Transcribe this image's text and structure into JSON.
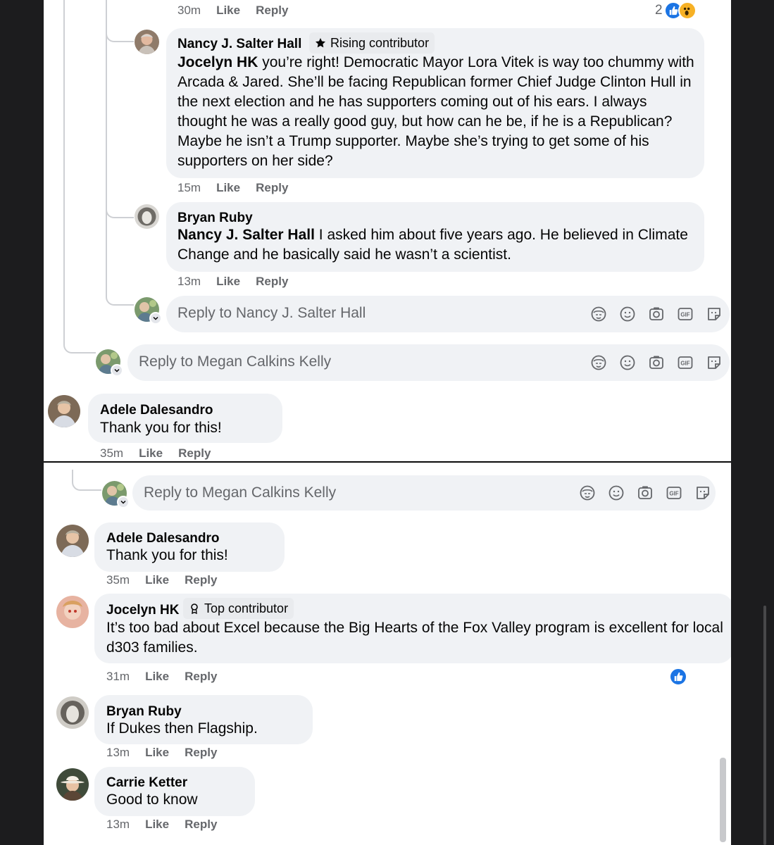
{
  "top": {
    "header_meta": {
      "time": "30m",
      "like": "Like",
      "reply": "Reply"
    },
    "header_reactions": {
      "count": "2",
      "icons": [
        "like-icon",
        "wow-icon"
      ]
    },
    "comments": [
      {
        "author": "Nancy J. Salter Hall",
        "badge": "Rising contributor",
        "badge_icon": "star-icon",
        "mention": "Jocelyn HK",
        "text": "you’re right! Democratic Mayor Lora Vitek is way too chummy with Arcada & Jared. She’ll be facing Republican former Chief Judge Clinton Hull in the next election and he has supporters coming out of his ears. I always thought he was a really good guy, but how can he be, if he is a Republican? Maybe he isn’t a Trump supporter. Maybe she’s trying to get some of his supporters on her side?",
        "time": "15m",
        "like": "Like",
        "reply": "Reply"
      },
      {
        "author": "Bryan Ruby",
        "mention": "Nancy J. Salter Hall",
        "text": "I asked him about five years ago. He believed in Climate Change and he basically said he wasn’t a scientist.",
        "time": "13m",
        "like": "Like",
        "reply": "Reply"
      }
    ],
    "reply_input_nested": {
      "placeholder": "Reply to Nancy J. Salter Hall"
    },
    "reply_input_outer": {
      "placeholder": "Reply to Megan Calkins Kelly"
    },
    "adele": {
      "author": "Adele Dalesandro",
      "text": "Thank you for this!",
      "time": "35m",
      "like": "Like",
      "reply": "Reply"
    }
  },
  "bottom": {
    "reply_input": {
      "placeholder": "Reply to Megan Calkins Kelly"
    },
    "comments": [
      {
        "author": "Adele Dalesandro",
        "text": "Thank you for this!",
        "time": "35m",
        "like": "Like",
        "reply": "Reply"
      },
      {
        "author": "Jocelyn HK",
        "badge": "Top contributor",
        "badge_icon": "award-icon",
        "text": "It’s too bad about Excel because the Big Hearts of the Fox Valley program is excellent for local d303 families.",
        "time": "31m",
        "like": "Like",
        "reply": "Reply",
        "reaction": "like-icon"
      },
      {
        "author": "Bryan Ruby",
        "text": "If Dukes then Flagship.",
        "time": "13m",
        "like": "Like",
        "reply": "Reply"
      },
      {
        "author": "Carrie Ketter",
        "text": "Good to know",
        "time": "13m",
        "like": "Like",
        "reply": "Reply"
      }
    ]
  },
  "input_icons": [
    "avatar-sticker-icon",
    "emoji-icon",
    "camera-icon",
    "gif-icon",
    "sticker-icon"
  ],
  "colors": {
    "bubble": "#f0f2f5",
    "meta": "#65676b",
    "like_blue": "#1b74e4",
    "background": "#1c1c1e"
  }
}
